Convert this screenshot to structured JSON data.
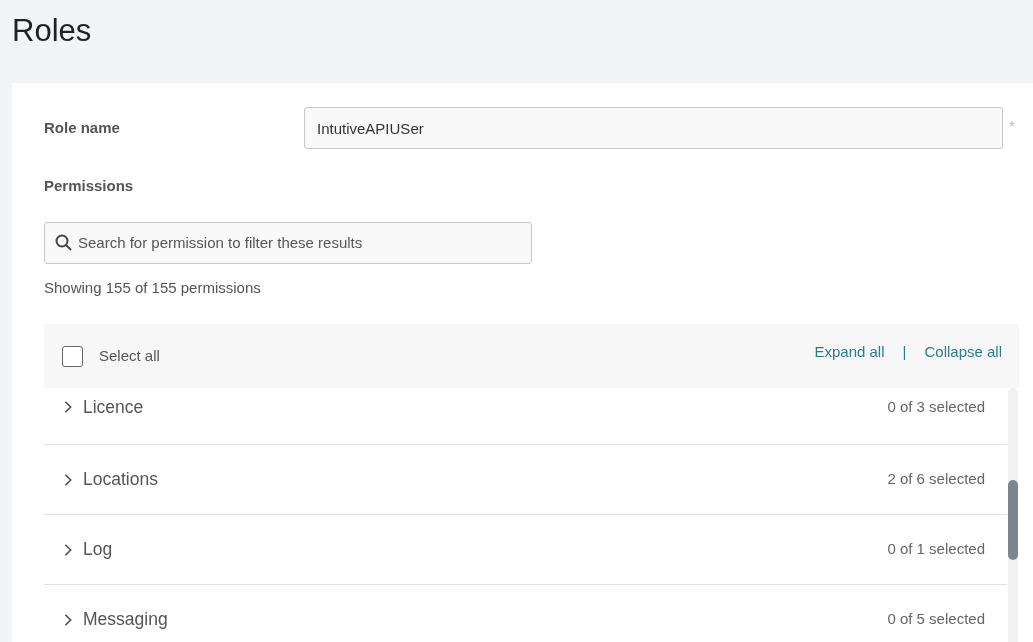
{
  "page": {
    "title": "Roles"
  },
  "role_name": {
    "label": "Role name",
    "value": "IntutiveAPIUSer",
    "required_mark": "*"
  },
  "permissions": {
    "label": "Permissions",
    "search": {
      "placeholder": "Search for permission to filter these results"
    },
    "count_text": "Showing 155 of 155 permissions",
    "select_all": {
      "label": "Select all",
      "checked": false
    },
    "expand_all": "Expand all",
    "separator": "|",
    "collapse_all": "Collapse all",
    "groups": [
      {
        "name": "Licence",
        "count": "0 of 3 selected",
        "expanded": false
      },
      {
        "name": "Locations",
        "count": "2 of 6 selected",
        "expanded": false
      },
      {
        "name": "Log",
        "count": "0 of 1 selected",
        "expanded": false
      },
      {
        "name": "Messaging",
        "count": "0 of 5 selected",
        "expanded": false
      }
    ]
  }
}
